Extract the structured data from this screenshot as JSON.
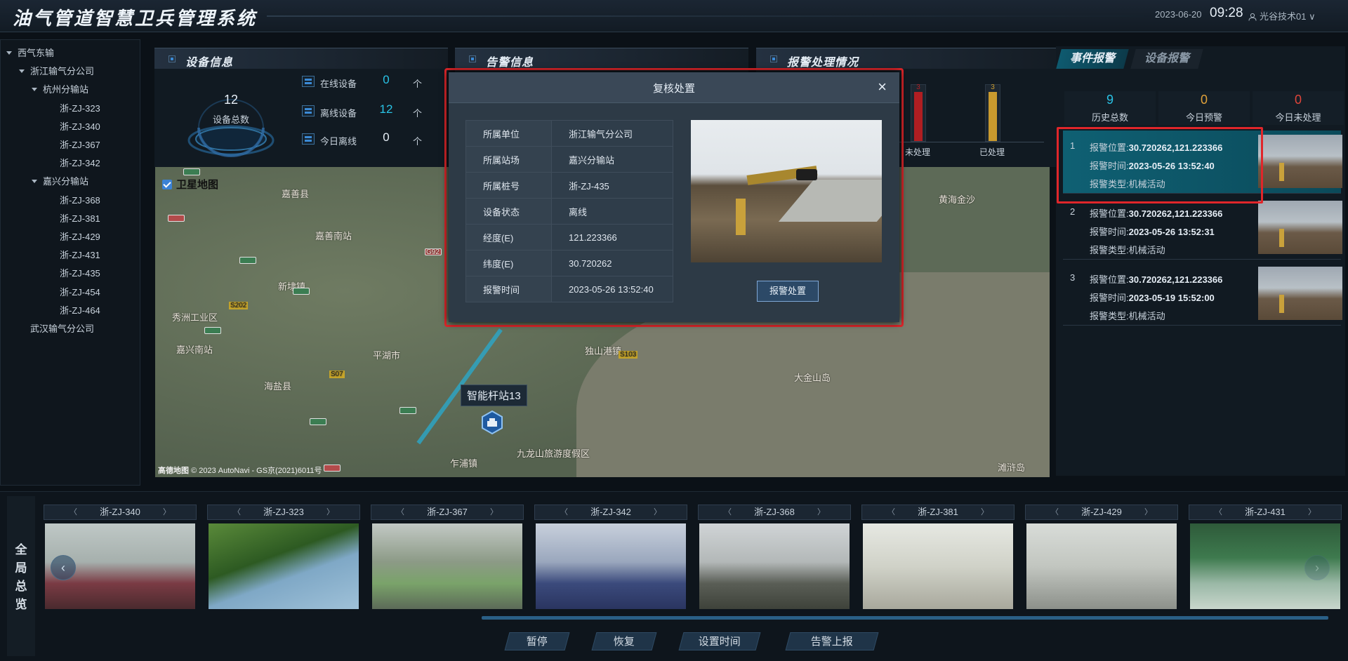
{
  "header": {
    "title": "油气管道智慧卫兵管理系统",
    "date": "2023-06-20",
    "time": "09:28",
    "user": "光谷技术01",
    "user_caret": "∨"
  },
  "tree": {
    "items": [
      {
        "label": "西气东输",
        "level": 0,
        "expanded": true
      },
      {
        "label": "浙江输气分公司",
        "level": 1,
        "expanded": true
      },
      {
        "label": "杭州分输站",
        "level": 2,
        "expanded": true
      },
      {
        "label": "浙-ZJ-323",
        "level": 3
      },
      {
        "label": "浙-ZJ-340",
        "level": 3
      },
      {
        "label": "浙-ZJ-367",
        "level": 3
      },
      {
        "label": "浙-ZJ-342",
        "level": 3
      },
      {
        "label": "嘉兴分输站",
        "level": 2,
        "expanded": true
      },
      {
        "label": "浙-ZJ-368",
        "level": 3
      },
      {
        "label": "浙-ZJ-381",
        "level": 3
      },
      {
        "label": "浙-ZJ-429",
        "level": 3
      },
      {
        "label": "浙-ZJ-431",
        "level": 3
      },
      {
        "label": "浙-ZJ-435",
        "level": 3
      },
      {
        "label": "浙-ZJ-454",
        "level": 3
      },
      {
        "label": "浙-ZJ-464",
        "level": 3
      },
      {
        "label": "武汉输气分公司",
        "level": 1
      }
    ]
  },
  "device_info": {
    "title": "设备信息",
    "total": "12",
    "total_label": "设备总数",
    "stats": [
      {
        "label": "在线设备",
        "value": "0",
        "unit": "个"
      },
      {
        "label": "离线设备",
        "value": "12",
        "unit": "个"
      },
      {
        "label": "今日离线",
        "value": "0",
        "unit": "个"
      }
    ]
  },
  "alarm_info": {
    "title": "告警信息"
  },
  "alarm_handling": {
    "title": "报警处理情况",
    "bars": [
      {
        "label": "未处理",
        "value": "3",
        "fill_fraction": 0.85,
        "color": "#b01e22"
      },
      {
        "label": "已处理",
        "value": "3",
        "fill_fraction": 0.85,
        "color": "#c99a2e"
      }
    ]
  },
  "map": {
    "satellite_label": "卫星地图",
    "station_label": "智能杆站13",
    "attribution": "高德地图",
    "copyright": "© 2023 AutoNavi - GS京(2021)6011号",
    "places": [
      "嘉善县",
      "嘉善南站",
      "平湖市",
      "新埭镇",
      "独山港镇",
      "嘉兴南站",
      "九龙山旅游度假区",
      "大金山岛",
      "黄海金沙",
      "秀洲工业区",
      "海盐县",
      "乍浦镇",
      "滩浒岛"
    ],
    "roads": [
      "S202",
      "S07",
      "S103",
      "G92"
    ]
  },
  "right_panel": {
    "tabs": [
      "事件报警",
      "设备报警"
    ],
    "kpis": [
      {
        "value": "9",
        "label": "历史总数",
        "color": "#29c3e6"
      },
      {
        "value": "0",
        "label": "今日预警",
        "color": "#e0a23a"
      },
      {
        "value": "0",
        "label": "今日未处理",
        "color": "#e0453a"
      }
    ],
    "alarms": [
      {
        "index": "1",
        "pos_label": "报警位置:",
        "pos": "30.720262,121.223366",
        "time_label": "报警时间:",
        "time": "2023-05-26 13:52:40",
        "type_label": "报警类型:",
        "type": "机械活动"
      },
      {
        "index": "2",
        "pos_label": "报警位置:",
        "pos": "30.720262,121.223366",
        "time_label": "报警时间:",
        "time": "2023-05-26 13:52:31",
        "type_label": "报警类型:",
        "type": "机械活动"
      },
      {
        "index": "3",
        "pos_label": "报警位置:",
        "pos": "30.720262,121.223366",
        "time_label": "报警时间:",
        "time": "2023-05-19 15:52:00",
        "type_label": "报警类型:",
        "type": "机械活动"
      }
    ]
  },
  "modal": {
    "title": "复核处置",
    "close": "×",
    "rows": [
      {
        "key": "所属单位",
        "value": "浙江输气分公司"
      },
      {
        "key": "所属站场",
        "value": "嘉兴分输站"
      },
      {
        "key": "所属桩号",
        "value": "浙-ZJ-435"
      },
      {
        "key": "设备状态",
        "value": "离线"
      },
      {
        "key": "经度(E)",
        "value": "121.223366"
      },
      {
        "key": "纬度(E)",
        "value": "30.720262"
      },
      {
        "key": "报警时间",
        "value": "2023-05-26 13:52:40"
      }
    ],
    "button": "报警处置"
  },
  "bottom": {
    "overview": [
      "全",
      "局",
      "总",
      "览"
    ],
    "cameras": [
      "浙-ZJ-340",
      "浙-ZJ-323",
      "浙-ZJ-367",
      "浙-ZJ-342",
      "浙-ZJ-368",
      "浙-ZJ-381",
      "浙-ZJ-429",
      "浙-ZJ-431"
    ],
    "buttons": [
      "暂停",
      "恢复",
      "设置时间",
      "告警上报"
    ]
  }
}
